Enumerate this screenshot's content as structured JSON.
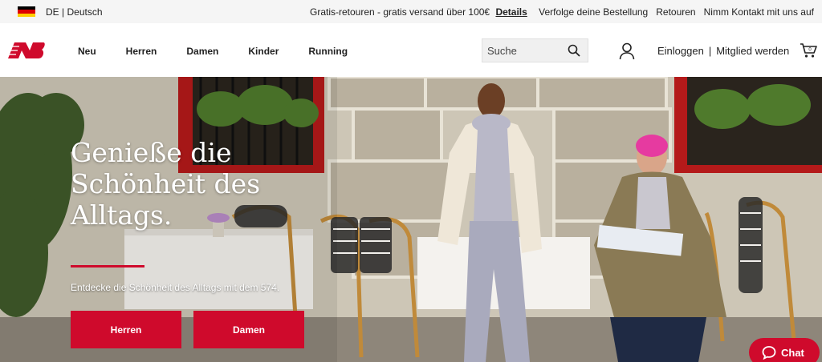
{
  "topbar": {
    "flag_colors": [
      "#000000",
      "#dd0000",
      "#ffce00"
    ],
    "lang_code": "DE",
    "lang_sep": "|",
    "lang_name": "Deutsch",
    "promo_text": "Gratis-retouren - gratis versand über 100€",
    "promo_link": "Details",
    "links": [
      "Verfolge deine Bestellung",
      "Retouren",
      "Nimm Kontakt mit uns auf"
    ]
  },
  "header": {
    "logo_icon": "new-balance-logo",
    "nav": [
      "Neu",
      "Herren",
      "Damen",
      "Kinder",
      "Running"
    ],
    "search_placeholder": "Suche",
    "search_icon": "search-icon",
    "user_icon": "user-icon",
    "login": "Einloggen",
    "auth_sep": "|",
    "register": "Mitglied werden",
    "cart_icon": "cart-icon"
  },
  "hero": {
    "headline": "Genieße die Schönheit des Alltags.",
    "subline": "Entdecke die Schönheit des Alltags mit dem 574.",
    "buttons": [
      "Herren",
      "Damen"
    ]
  },
  "chat": {
    "label": "Chat",
    "icon": "chat-bubble-icon"
  },
  "colors": {
    "brand_red": "#cf0a2c",
    "topbar_bg": "#f5f5f5"
  }
}
